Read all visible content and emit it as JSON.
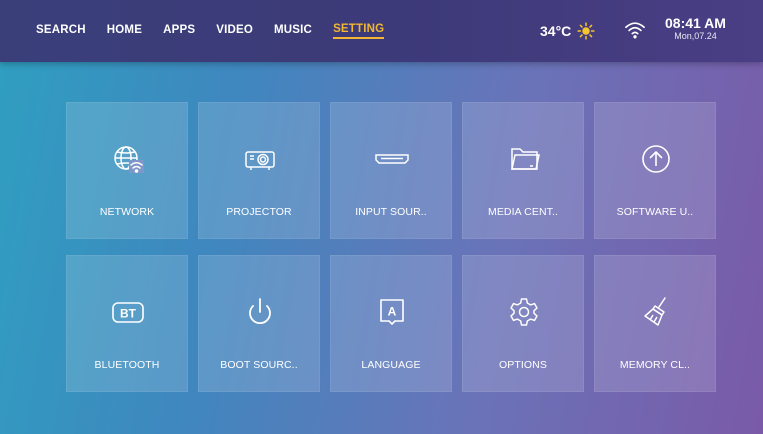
{
  "nav": {
    "items": [
      "SEARCH",
      "HOME",
      "APPS",
      "VIDEO",
      "MUSIC",
      "SETTING"
    ],
    "active": "SETTING"
  },
  "status": {
    "temperature": "34°C",
    "time": "08:41 AM",
    "date": "Mon,07.24"
  },
  "tiles": [
    {
      "label": "NETWORK",
      "icon": "globe-wifi-icon"
    },
    {
      "label": "PROJECTOR",
      "icon": "projector-icon"
    },
    {
      "label": "INPUT SOUR..",
      "icon": "hdmi-port-icon"
    },
    {
      "label": "MEDIA CENT..",
      "icon": "folder-icon"
    },
    {
      "label": "SOFTWARE U..",
      "icon": "upload-arrow-icon"
    },
    {
      "label": "BLUETOOTH",
      "icon": "bt-icon"
    },
    {
      "label": "BOOT SOURC..",
      "icon": "power-icon"
    },
    {
      "label": "LANGUAGE",
      "icon": "language-icon"
    },
    {
      "label": "OPTIONS",
      "icon": "gear-icon"
    },
    {
      "label": "MEMORY CL..",
      "icon": "broom-icon"
    }
  ],
  "colors": {
    "accent": "#f2b632",
    "topbar": "#3c3a78",
    "tile": "rgba(255,255,255,0.15)"
  }
}
